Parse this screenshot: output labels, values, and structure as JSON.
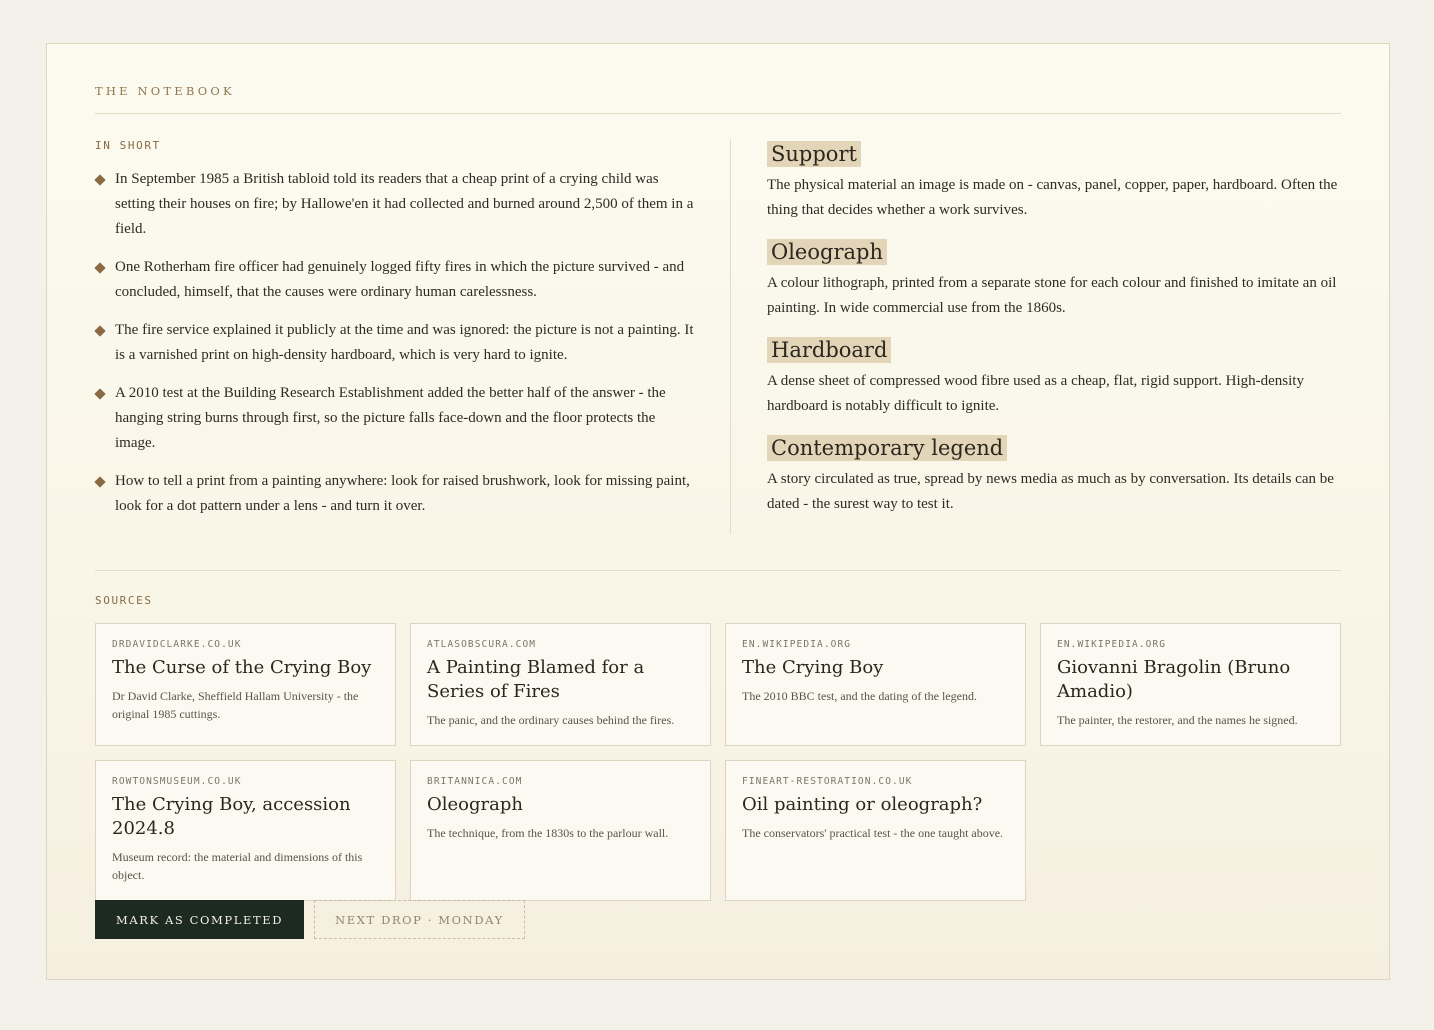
{
  "header": {
    "title": "THE NOTEBOOK"
  },
  "in_short": {
    "label": "IN SHORT",
    "bullets": [
      "In September 1985 a British tabloid told its readers that a cheap print of a crying child was setting their houses on fire; by Hallowe'en it had collected and burned around 2,500 of them in a field.",
      "One Rotherham fire officer had genuinely logged fifty fires in which the picture survived - and concluded, himself, that the causes were ordinary human carelessness.",
      "The fire service explained it publicly at the time and was ignored: the picture is not a painting. It is a varnished print on high-density hardboard, which is very hard to ignite.",
      "A 2010 test at the Building Research Establishment added the better half of the answer - the hanging string burns through first, so the picture falls face-down and the floor protects the image.",
      "How to tell a print from a painting anywhere: look for raised brushwork, look for missing paint, look for a dot pattern under a lens - and turn it over."
    ]
  },
  "glossary": [
    {
      "term": "Support",
      "definition": "The physical material an image is made on - canvas, panel, copper, paper, hardboard. Often the thing that decides whether a work survives."
    },
    {
      "term": "Oleograph",
      "definition": "A colour lithograph, printed from a separate stone for each colour and finished to imitate an oil painting. In wide commercial use from the 1860s."
    },
    {
      "term": "Hardboard",
      "definition": "A dense sheet of compressed wood fibre used as a cheap, flat, rigid support. High-density hardboard is notably difficult to ignite."
    },
    {
      "term": "Contemporary legend",
      "definition": "A story circulated as true, spread by news media as much as by conversation. Its details can be dated - the surest way to test it."
    }
  ],
  "sources": {
    "label": "SOURCES",
    "items": [
      {
        "domain": "DRDAVIDCLARKE.CO.UK",
        "title": "The Curse of the Crying Boy",
        "description": "Dr David Clarke, Sheffield Hallam University - the original 1985 cuttings."
      },
      {
        "domain": "ATLASOBSCURA.COM",
        "title": "A Painting Blamed for a Series of Fires",
        "description": "The panic, and the ordinary causes behind the fires."
      },
      {
        "domain": "EN.WIKIPEDIA.ORG",
        "title": "The Crying Boy",
        "description": "The 2010 BBC test, and the dating of the legend."
      },
      {
        "domain": "EN.WIKIPEDIA.ORG",
        "title": "Giovanni Bragolin (Bruno Amadio)",
        "description": "The painter, the restorer, and the names he signed."
      },
      {
        "domain": "ROWTONSMUSEUM.CO.UK",
        "title": "The Crying Boy, accession 2024.8",
        "description": "Museum record: the material and dimensions of this object."
      },
      {
        "domain": "BRITANNICA.COM",
        "title": "Oleograph",
        "description": "The technique, from the 1830s to the parlour wall."
      },
      {
        "domain": "FINEART-RESTORATION.CO.UK",
        "title": "Oil painting or oleograph?",
        "description": "The conservators' practical test - the one taught above."
      }
    ]
  },
  "actions": {
    "complete_label": "MARK AS COMPLETED",
    "next_label": "NEXT DROP · MONDAY"
  },
  "colors": {
    "accent": "#8a6a44",
    "highlight": "#e3d5b8",
    "primary_button": "#1d2a22"
  }
}
